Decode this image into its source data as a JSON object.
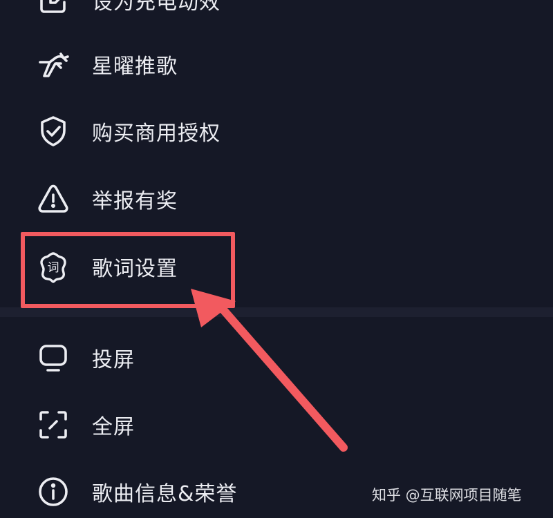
{
  "menu": {
    "items": [
      {
        "label": "设为充电动效",
        "icon": "edit-square-icon"
      },
      {
        "label": "星曜推歌",
        "icon": "running-rocket-icon"
      },
      {
        "label": "购买商用授权",
        "icon": "shield-check-icon"
      },
      {
        "label": "举报有奖",
        "icon": "warning-triangle-icon"
      },
      {
        "label": "歌词设置",
        "icon": "lyrics-badge-icon",
        "icon_text": "词"
      },
      {
        "label": "投屏",
        "icon": "cast-screen-icon"
      },
      {
        "label": "全屏",
        "icon": "fullscreen-icon"
      },
      {
        "label": "歌曲信息&荣誉",
        "icon": "info-circle-icon"
      }
    ]
  },
  "annotation": {
    "highlight_color": "#f25a5f",
    "highlighted_item": "歌词设置"
  },
  "watermark": {
    "text": "知乎 @互联网项目随笔"
  },
  "colors": {
    "background": "#151826",
    "divider": "#1d2030",
    "text": "#ecedf2",
    "accent": "#f25a5f"
  }
}
